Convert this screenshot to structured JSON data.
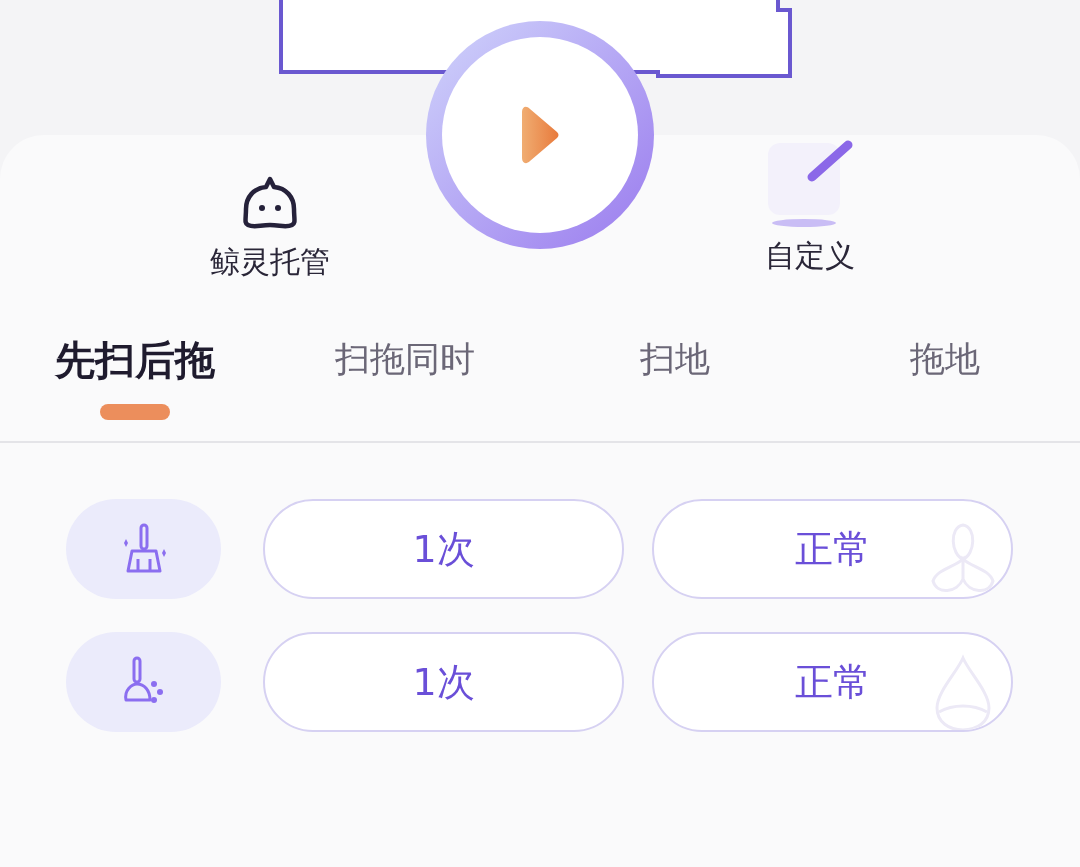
{
  "modes": [
    {
      "label": "鲸灵托管",
      "kind": "auto"
    },
    {
      "label": "自定义",
      "kind": "custom"
    }
  ],
  "tabs": [
    {
      "label": "先扫后拖",
      "selected": true
    },
    {
      "label": "扫拖同时",
      "selected": false
    },
    {
      "label": "扫地",
      "selected": false
    },
    {
      "label": "拖地",
      "selected": false
    }
  ],
  "rows": [
    {
      "kind": "sweep",
      "times": "1次",
      "power": "正常"
    },
    {
      "kind": "mop",
      "times": "1次",
      "power": "正常"
    }
  ]
}
